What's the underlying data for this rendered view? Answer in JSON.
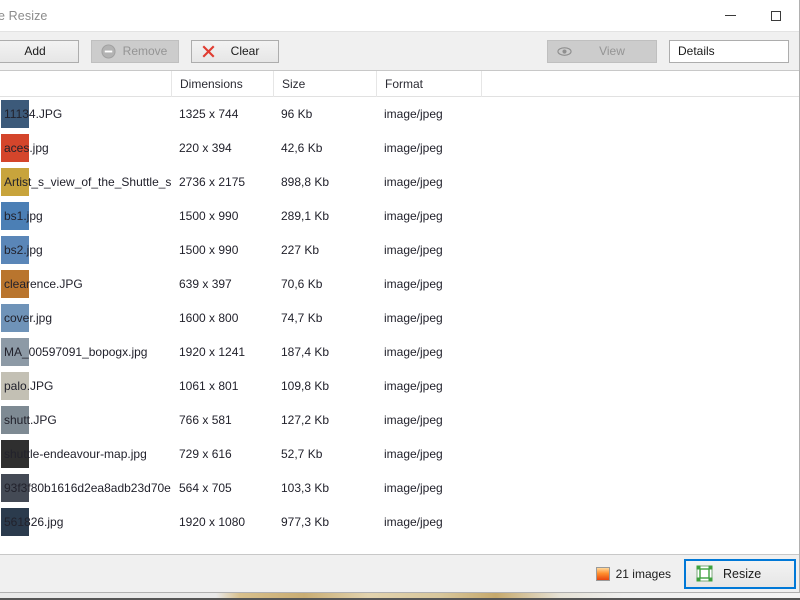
{
  "window": {
    "title": "ge Resize",
    "minimize_label": "minimize",
    "maximize_label": "maximize"
  },
  "toolbar": {
    "add_label": "Add",
    "remove_label": "Remove",
    "clear_label": "Clear",
    "view_label": "View",
    "details_label": "Details"
  },
  "list": {
    "columns": [
      "",
      "Dimensions",
      "Size",
      "Format"
    ],
    "rows": [
      {
        "name": "11134.JPG",
        "dimensions": "1325 x 744",
        "size": "96 Kb",
        "format": "image/jpeg",
        "thumb": "#3c5a7a"
      },
      {
        "name": "aces.jpg",
        "dimensions": "220 x 394",
        "size": "42,6 Kb",
        "format": "image/jpeg",
        "thumb": "#d4452b"
      },
      {
        "name": "Artist_s_view_of_the_Shuttle_s...",
        "dimensions": "2736 x 2175",
        "size": "898,8 Kb",
        "format": "image/jpeg",
        "thumb": "#c8a43c"
      },
      {
        "name": "bs1.jpg",
        "dimensions": "1500 x 990",
        "size": "289,1 Kb",
        "format": "image/jpeg",
        "thumb": "#4b7fb5"
      },
      {
        "name": "bs2.jpg",
        "dimensions": "1500 x 990",
        "size": "227 Kb",
        "format": "image/jpeg",
        "thumb": "#5a86b8"
      },
      {
        "name": "clearence.JPG",
        "dimensions": "639 x 397",
        "size": "70,6 Kb",
        "format": "image/jpeg",
        "thumb": "#b9752e"
      },
      {
        "name": "cover.jpg",
        "dimensions": "1600 x 800",
        "size": "74,7 Kb",
        "format": "image/jpeg",
        "thumb": "#6f93b8"
      },
      {
        "name": "MA_00597091_bopogx.jpg",
        "dimensions": "1920 x 1241",
        "size": "187,4 Kb",
        "format": "image/jpeg",
        "thumb": "#8d9aa6"
      },
      {
        "name": "palo.JPG",
        "dimensions": "1061 x 801",
        "size": "109,8 Kb",
        "format": "image/jpeg",
        "thumb": "#c3c0b4"
      },
      {
        "name": "shutt.JPG",
        "dimensions": "766 x 581",
        "size": "127,2 Kb",
        "format": "image/jpeg",
        "thumb": "#7e8a93"
      },
      {
        "name": "shuttle-endeavour-map.jpg",
        "dimensions": "729 x 616",
        "size": "52,7 Kb",
        "format": "image/jpeg",
        "thumb": "#2f2f2f"
      },
      {
        "name": "93f3f80b1616d2ea8adb23d70e...",
        "dimensions": "564 x 705",
        "size": "103,3 Kb",
        "format": "image/jpeg",
        "thumb": "#444a55"
      },
      {
        "name": "561826.jpg",
        "dimensions": "1920 x 1080",
        "size": "977,3 Kb",
        "format": "image/jpeg",
        "thumb": "#2b3b4d"
      }
    ]
  },
  "status": {
    "count_label": "21 images",
    "resize_label": "Resize"
  },
  "colors": {
    "accent": "#0078d7",
    "toolbar_bg": "#f0f0f0",
    "clear_icon": "#e03c31",
    "resize_icon": "#3fa13f"
  }
}
